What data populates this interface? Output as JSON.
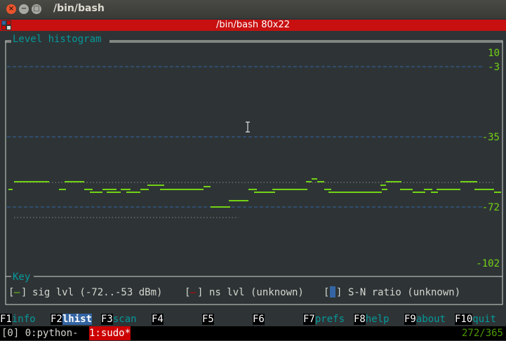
{
  "window": {
    "title": "/bin/bash",
    "close_glyph": "×",
    "minimize_glyph": "−",
    "maximize_glyph": "□"
  },
  "tab": {
    "title": "/bin/bash 80x22"
  },
  "histogram": {
    "title": "Level histogram",
    "y_ticks": [
      "10",
      "-3",
      "-35",
      "-72",
      "-102"
    ]
  },
  "key": {
    "title": "Key",
    "items": [
      {
        "bracket_open": "[",
        "swatch": "—",
        "bracket_close": "]",
        "label": "sig lvl (-72..-53 dBm)",
        "color": "#73d216"
      },
      {
        "bracket_open": "[",
        "swatch": "—",
        "bracket_close": "]",
        "label": "ns lvl (unknown)",
        "color": "#cc0000"
      },
      {
        "bracket_open": "[",
        "swatch": " ",
        "bracket_close": "]",
        "label": "S-N ratio (unknown)",
        "color": "#3465a4"
      }
    ]
  },
  "function_keys": [
    {
      "key": "F1",
      "label": "info",
      "active": false
    },
    {
      "key": "F2",
      "label": "lhist",
      "active": true
    },
    {
      "key": "F3",
      "label": "scan",
      "active": false
    },
    {
      "key": "F4",
      "label": "",
      "active": false
    },
    {
      "key": "F5",
      "label": "",
      "active": false
    },
    {
      "key": "F6",
      "label": "",
      "active": false
    },
    {
      "key": "F7",
      "label": "prefs",
      "active": false
    },
    {
      "key": "F8",
      "label": "help",
      "active": false
    },
    {
      "key": "F9",
      "label": "about",
      "active": false
    },
    {
      "key": "F10",
      "label": "quit",
      "active": false
    }
  ],
  "status": {
    "window0": "[0] 0:python-",
    "window1": "1:sudo*",
    "position": "272/365"
  },
  "colors": {
    "signal": "#73d216",
    "noise_dots": "#6a6f6a",
    "grid": "#3465a4",
    "frame": "#d3d7cf",
    "title_text": "#06989a",
    "active_tab_bar": "#c81010"
  }
}
